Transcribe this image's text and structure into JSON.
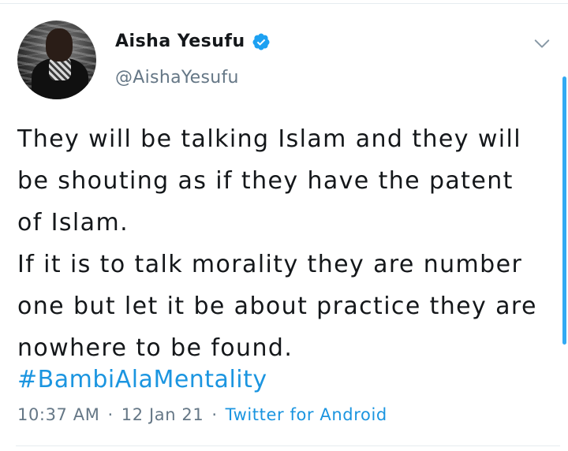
{
  "author": {
    "display_name": "Aisha Yesufu",
    "handle": "@AishaYesufu",
    "verified": true,
    "avatar_icon": "profile-photo"
  },
  "tweet": {
    "lines": [
      "They will be talking Islam and they will",
      "be shouting as if they have the patent",
      "of Islam.",
      "If it is to talk morality they are number",
      "one but let it be about practice they are",
      "nowhere to be found."
    ],
    "hashtag": "#BambiAlaMentality"
  },
  "meta": {
    "time": "10:37 AM",
    "separator": "·",
    "date": "12 Jan 21",
    "source": "Twitter for Android"
  },
  "icons": {
    "verified": "verified-badge-icon",
    "more": "chevron-down-icon"
  },
  "colors": {
    "link": "#1b95e0",
    "verified": "#1da1f2",
    "secondary_text": "#657786",
    "primary_text": "#14171a"
  }
}
